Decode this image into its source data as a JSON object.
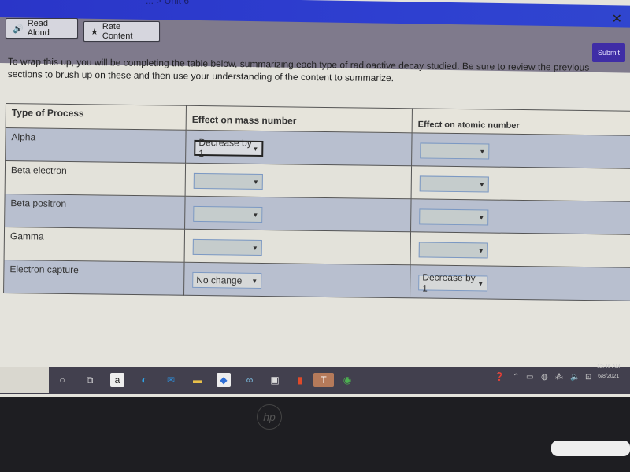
{
  "header": {
    "breadcrumb": "... > Unit 6",
    "close_icon": "close-icon"
  },
  "toolbar": {
    "read_aloud_label": "Read Aloud",
    "rate_content_label": "Rate Content",
    "submit_label": "Submit"
  },
  "intro_text": "To wrap this up, you will be completing the table below, summarizing each type of radioactive decay studied.  Be sure to review the previous sections to brush up on these and then use your understanding of the content to summarize.",
  "table": {
    "headers": [
      "Type of Process",
      "Effect on mass number",
      "Effect on atomic number"
    ],
    "rows": [
      {
        "process": "Alpha",
        "mass": "Decrease by 1",
        "atomic": ""
      },
      {
        "process": "Beta electron",
        "mass": "",
        "atomic": ""
      },
      {
        "process": "Beta positron",
        "mass": "",
        "atomic": ""
      },
      {
        "process": "Gamma",
        "mass": "",
        "atomic": ""
      },
      {
        "process": "Electron capture",
        "mass": "No change",
        "atomic": "Decrease by 1"
      }
    ]
  },
  "taskbar": {
    "icons": [
      "cortana-icon",
      "task-view-icon",
      "amazon-icon",
      "edge-icon",
      "mail-icon",
      "file-explorer-icon",
      "dropbox-icon",
      "infinity-app-icon",
      "store-icon",
      "office-icon",
      "teams-icon",
      "chrome-icon"
    ],
    "time": "12:46 AM",
    "date": "6/8/2021"
  },
  "bezel": {
    "logo": "hp"
  }
}
